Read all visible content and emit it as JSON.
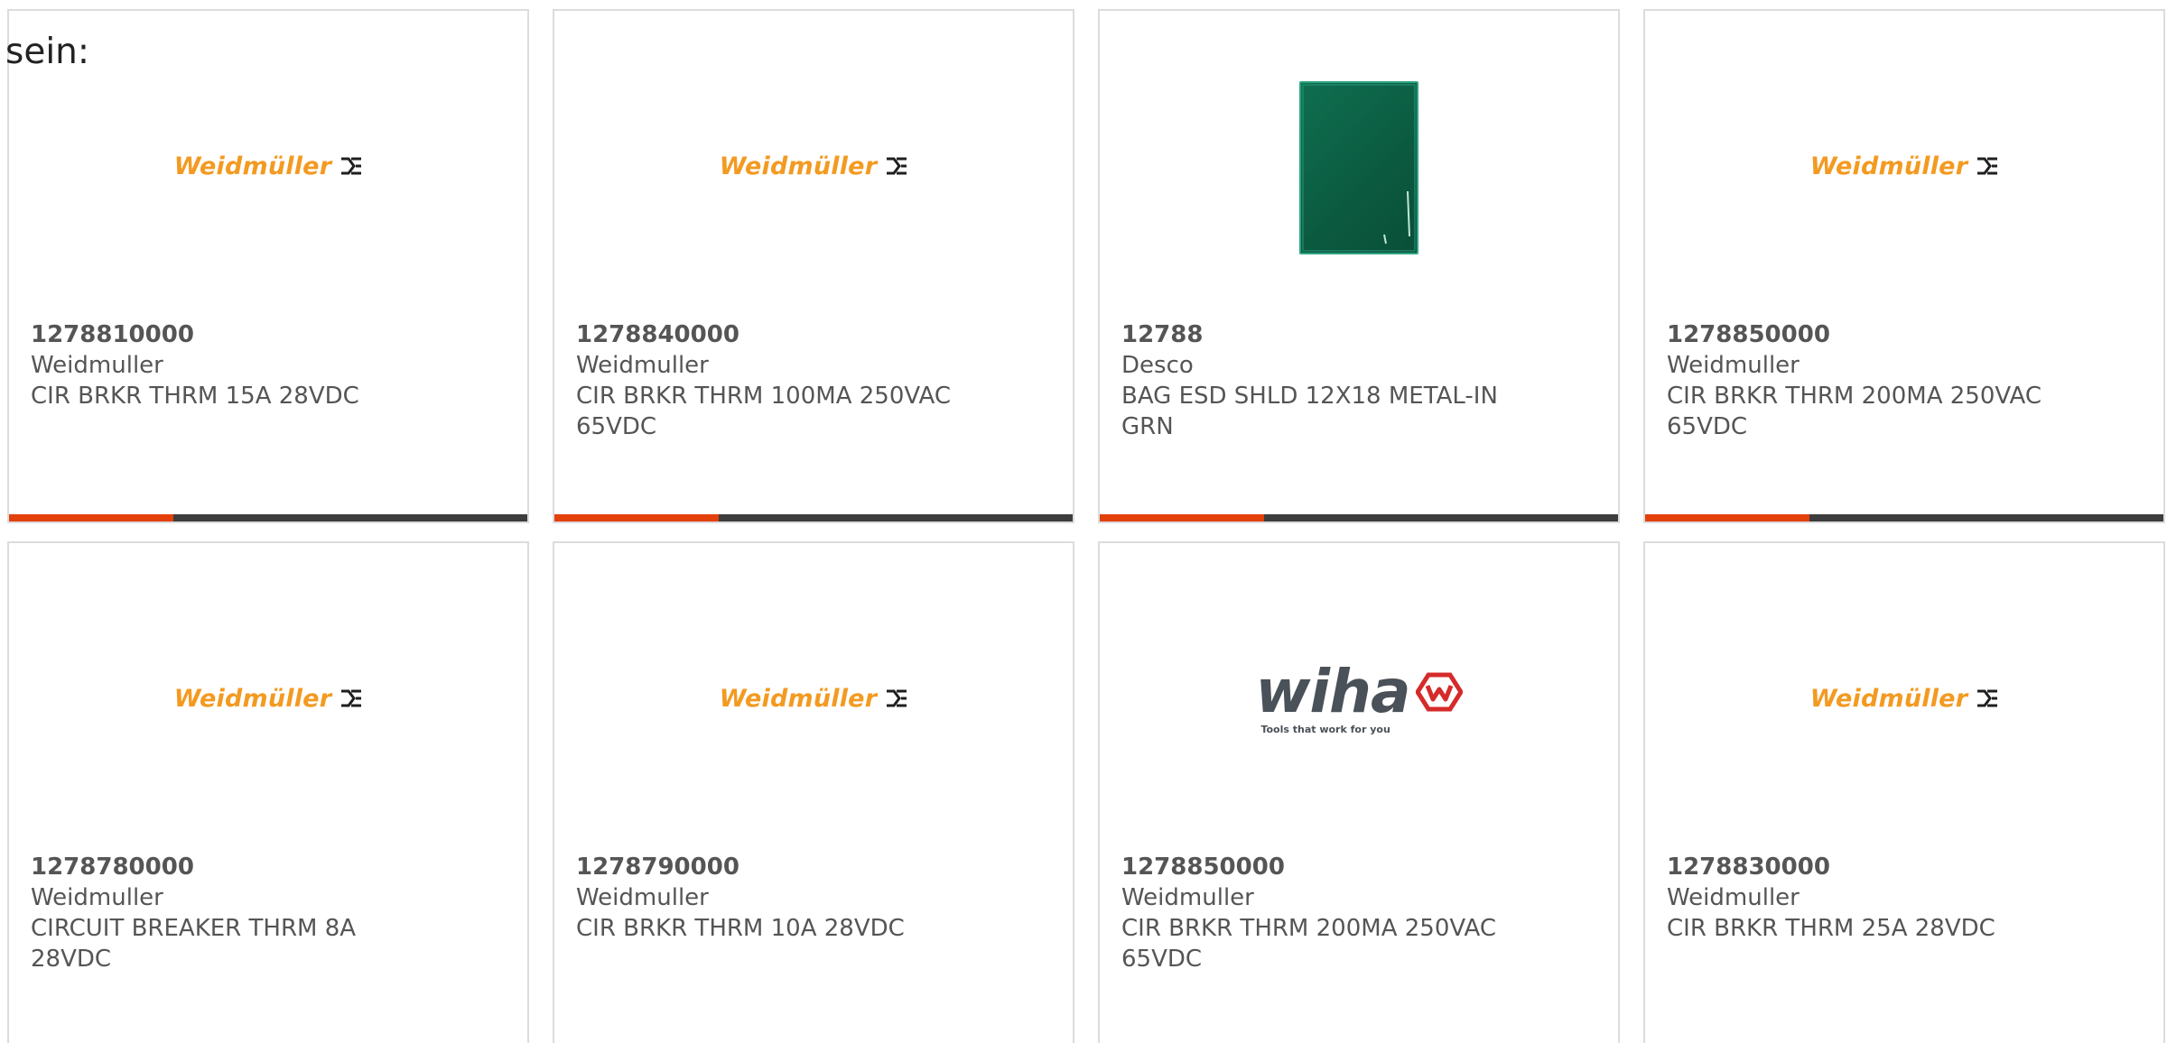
{
  "intro_text": "sein:",
  "colors": {
    "accent": "#e4400c",
    "bar": "#3d3d3d",
    "weidmuller_orange": "#f39a21",
    "wiha_gray": "#4a5158",
    "wiha_red": "#d52b2b"
  },
  "products": [
    {
      "part_number": "1278810000",
      "manufacturer": "Weidmuller",
      "description": "CIR BRKR THRM 15A 28VDC",
      "image": {
        "type": "weidmuller-logo",
        "text": "Weidmüller"
      }
    },
    {
      "part_number": "1278840000",
      "manufacturer": "Weidmuller",
      "description": "CIR BRKR THRM 100MA 250VAC 65VDC",
      "image": {
        "type": "weidmuller-logo",
        "text": "Weidmüller"
      }
    },
    {
      "part_number": "12788",
      "manufacturer": "Desco",
      "description": "BAG ESD SHLD 12X18 METAL-IN GRN",
      "image": {
        "type": "esd-bag-photo"
      }
    },
    {
      "part_number": "1278850000",
      "manufacturer": "Weidmuller",
      "description": "CIR BRKR THRM 200MA 250VAC 65VDC",
      "image": {
        "type": "weidmuller-logo",
        "text": "Weidmüller"
      }
    },
    {
      "part_number": "1278780000",
      "manufacturer": "Weidmuller",
      "description": "CIRCUIT BREAKER THRM 8A 28VDC",
      "image": {
        "type": "weidmuller-logo",
        "text": "Weidmüller"
      }
    },
    {
      "part_number": "1278790000",
      "manufacturer": "Weidmuller",
      "description": "CIR BRKR THRM 10A 28VDC",
      "image": {
        "type": "weidmuller-logo",
        "text": "Weidmüller"
      }
    },
    {
      "part_number": "1278850000",
      "manufacturer": "Weidmuller",
      "description": "CIR BRKR THRM 200MA 250VAC 65VDC",
      "image": {
        "type": "wiha-logo",
        "text": "wiha",
        "tagline": "Tools that work for you"
      }
    },
    {
      "part_number": "1278830000",
      "manufacturer": "Weidmuller",
      "description": "CIR BRKR THRM 25A 28VDC",
      "image": {
        "type": "weidmuller-logo",
        "text": "Weidmüller"
      }
    }
  ]
}
